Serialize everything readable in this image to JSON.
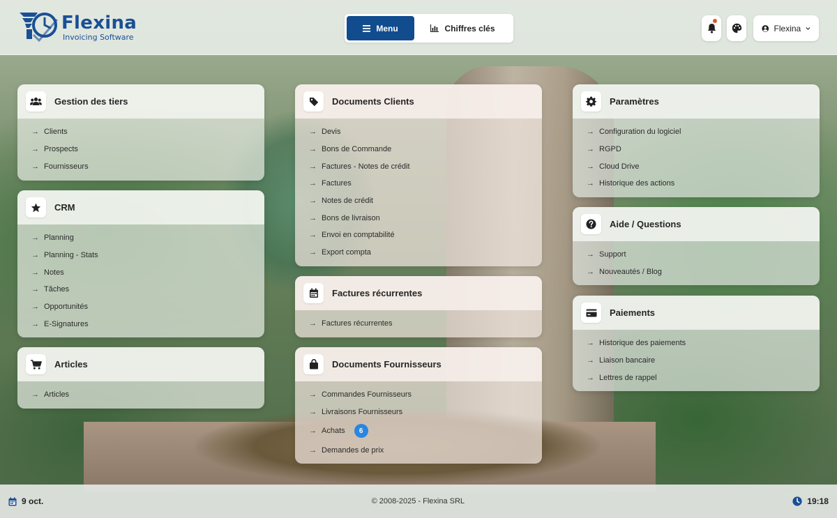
{
  "brand": {
    "name": "Flexina",
    "tagline": "Invoicing Software",
    "color": "#1a4f96"
  },
  "nav": {
    "menu_label": "Menu",
    "kpi_label": "Chiffres clés",
    "active_color": "#114c8f"
  },
  "header": {
    "user_name": "Flexina"
  },
  "cards": {
    "tiers": {
      "title": "Gestion des tiers",
      "icon": "users-icon",
      "items": [
        "Clients",
        "Prospects",
        "Fournisseurs"
      ]
    },
    "crm": {
      "title": "CRM",
      "icon": "star-icon",
      "items": [
        "Planning",
        "Planning - Stats",
        "Notes",
        "Tâches",
        "Opportunités",
        "E-Signatures"
      ]
    },
    "articles": {
      "title": "Articles",
      "icon": "cart-icon",
      "items": [
        "Articles"
      ]
    },
    "docs_clients": {
      "title": "Documents Clients",
      "icon": "tag-icon",
      "items": [
        "Devis",
        "Bons de Commande",
        "Factures - Notes de crédit",
        "Factures",
        "Notes de crédit",
        "Bons de livraison",
        "Envoi en comptabilité",
        "Export compta"
      ]
    },
    "recurrentes": {
      "title": "Factures récurrentes",
      "icon": "calendar-icon",
      "items": [
        "Factures récurrentes"
      ]
    },
    "docs_fournisseurs": {
      "title": "Documents Fournisseurs",
      "icon": "bag-icon",
      "items": [
        "Commandes Fournisseurs",
        "Livraisons Fournisseurs",
        "Achats",
        "Demandes de prix"
      ],
      "achats_badge": "6"
    },
    "parametres": {
      "title": "Paramètres",
      "icon": "gear-icon",
      "items": [
        "Configuration du logiciel",
        "RGPD",
        "Cloud Drive",
        "Historique des actions"
      ]
    },
    "aide": {
      "title": "Aide / Questions",
      "icon": "question-icon",
      "items": [
        "Support",
        "Nouveautés / Blog"
      ]
    },
    "paiements": {
      "title": "Paiements",
      "icon": "credit-card-icon",
      "items": [
        "Historique des paiements",
        "Liaison bancaire",
        "Lettres de rappel"
      ]
    }
  },
  "footer": {
    "date": "9 oct.",
    "copyright": "© 2008-2025 - Flexina SRL",
    "time": "19:18",
    "accent": "#1a4f96"
  }
}
